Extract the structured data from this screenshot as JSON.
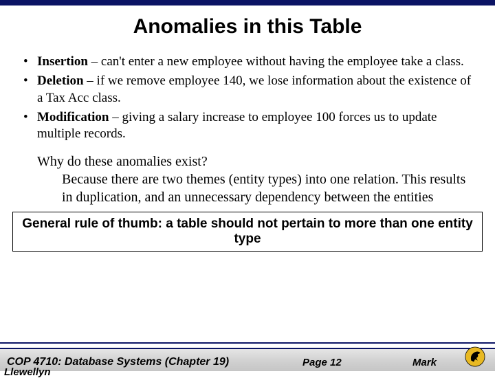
{
  "title": "Anomalies in this Table",
  "bullets": [
    {
      "term": "Insertion",
      "text": " – can't enter a new employee without having the employee take a class."
    },
    {
      "term": "Deletion",
      "text": " – if we remove employee 140, we lose information about the existence of a Tax Acc class."
    },
    {
      "term": "Modification",
      "text": " – giving a salary increase to employee 100 forces us to update multiple records."
    }
  ],
  "why": {
    "q": "Why do these anomalies exist?",
    "a": "Because there are two themes (entity types) into one relation. This results in duplication, and an unnecessary dependency between the entities"
  },
  "rule": "General rule of thumb: a table should not pertain to more than one entity type",
  "footer": {
    "course": "COP 4710: Database Systems  (Chapter 19)",
    "page": "Page 12",
    "author": "Mark",
    "partial": "Llewellyn"
  }
}
